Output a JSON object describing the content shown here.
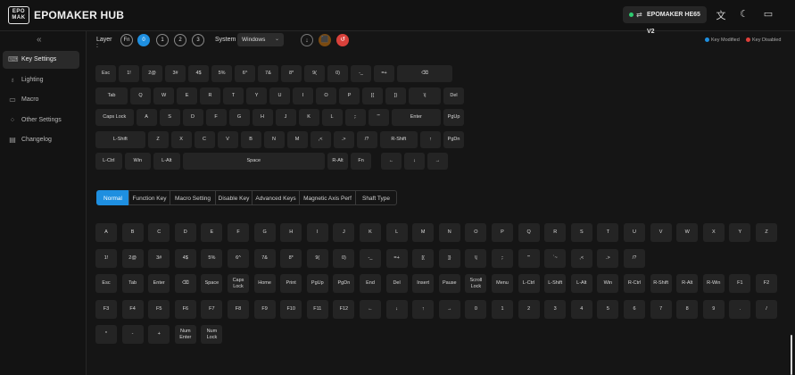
{
  "header": {
    "logo_text": "EPOMAKER",
    "app_title": "EPOMAKER HUB",
    "device_name": "EPOMAKER HE65 V2",
    "device_status_color": "#2ecc71",
    "icons": [
      "swap-icon",
      "translate-icon",
      "moon-icon",
      "message-icon"
    ]
  },
  "sidebar": {
    "collapse_icon": "double-chevron-left-icon",
    "items": [
      {
        "label": "Key Settings",
        "icon": "keyboard-icon",
        "active": true
      },
      {
        "label": "Lighting",
        "icon": "bulb-icon",
        "active": false
      },
      {
        "label": "Macro",
        "icon": "macro-icon",
        "active": false
      },
      {
        "label": "Other Settings",
        "icon": "grid-icon",
        "active": false
      },
      {
        "label": "Changelog",
        "icon": "document-icon",
        "active": false
      }
    ]
  },
  "layer_bar": {
    "layer_label": "Layer :",
    "layers": [
      "Fn",
      "0",
      "1",
      "2",
      "3"
    ],
    "active_layer": "0",
    "system_label": "System",
    "system_value": "Windows",
    "action_colors": [
      "#3a3a3a",
      "#7a4a10",
      "#d9413b"
    ],
    "legend": [
      {
        "label": "Key Modified",
        "color": "#1e8fe0"
      },
      {
        "label": "Key Disabled",
        "color": "#e0403a"
      }
    ]
  },
  "keyboard": {
    "rows": [
      [
        "Esc",
        "1!",
        "2@",
        "3#",
        "4$",
        "5%",
        "6^",
        "7&",
        "8*",
        "9(",
        "0)",
        "-_",
        "=+",
        "⌫"
      ],
      [
        "Tab",
        "Q",
        "W",
        "E",
        "R",
        "T",
        "Y",
        "U",
        "I",
        "O",
        "P",
        "[{",
        "]}",
        "\\|",
        "Del"
      ],
      [
        "Caps Lock",
        "A",
        "S",
        "D",
        "F",
        "G",
        "H",
        "J",
        "K",
        "L",
        ";:",
        "'\"",
        "Enter",
        "PgUp"
      ],
      [
        "L-Shift",
        "Z",
        "X",
        "C",
        "V",
        "B",
        "N",
        "M",
        ",<",
        ".>",
        "/?",
        "R-Shift",
        "↑",
        "PgDn"
      ],
      [
        "L-Ctrl",
        "Win",
        "L-Alt",
        "Space",
        "R-Alt",
        "Fn",
        "←",
        "↓",
        "→"
      ]
    ]
  },
  "tabs": [
    "Normal",
    "Function Key",
    "Macro Setting",
    "Disable Key",
    "Advanced Keys",
    "Magnetic Axis Perf",
    "Shaft Type"
  ],
  "active_tab": "Normal",
  "key_grid": {
    "rows": [
      [
        "A",
        "B",
        "C",
        "D",
        "E",
        "F",
        "G",
        "H",
        "I",
        "J",
        "K",
        "L",
        "M",
        "N",
        "O",
        "P",
        "Q",
        "R",
        "S",
        "T",
        "U",
        "V",
        "W",
        "X",
        "Y",
        "Z"
      ],
      [
        "1!",
        "2@",
        "3#",
        "4$",
        "5%",
        "6^",
        "7&",
        "8*",
        "9(",
        "0)",
        "-_",
        "=+",
        "[{",
        "]}",
        "\\|",
        ";:",
        "'\"",
        "`~",
        ",<",
        ".>",
        "/?"
      ],
      [
        "Esc",
        "Tab",
        "Enter",
        "⌫",
        "Space",
        "Caps\nLock",
        "Home",
        "Print",
        "PgUp",
        "PgDn",
        "End",
        "Del",
        "Insert",
        "Pause",
        "Scroll\nLock",
        "Menu",
        "L-Ctrl",
        "L-Shift",
        "L-Alt",
        "Win",
        "R-Ctrl",
        "R-Shift",
        "R-Alt",
        "R-Win",
        "F1",
        "F2"
      ],
      [
        "F3",
        "F4",
        "F5",
        "F6",
        "F7",
        "F8",
        "F9",
        "F10",
        "F11",
        "F12",
        "←",
        "↓",
        "↑",
        "→",
        "0",
        "1",
        "2",
        "3",
        "4",
        "5",
        "6",
        "7",
        "8",
        "9",
        ".",
        "/"
      ],
      [
        "*",
        "-",
        "+",
        "Num\nEnter",
        "Num\nLock"
      ]
    ]
  }
}
